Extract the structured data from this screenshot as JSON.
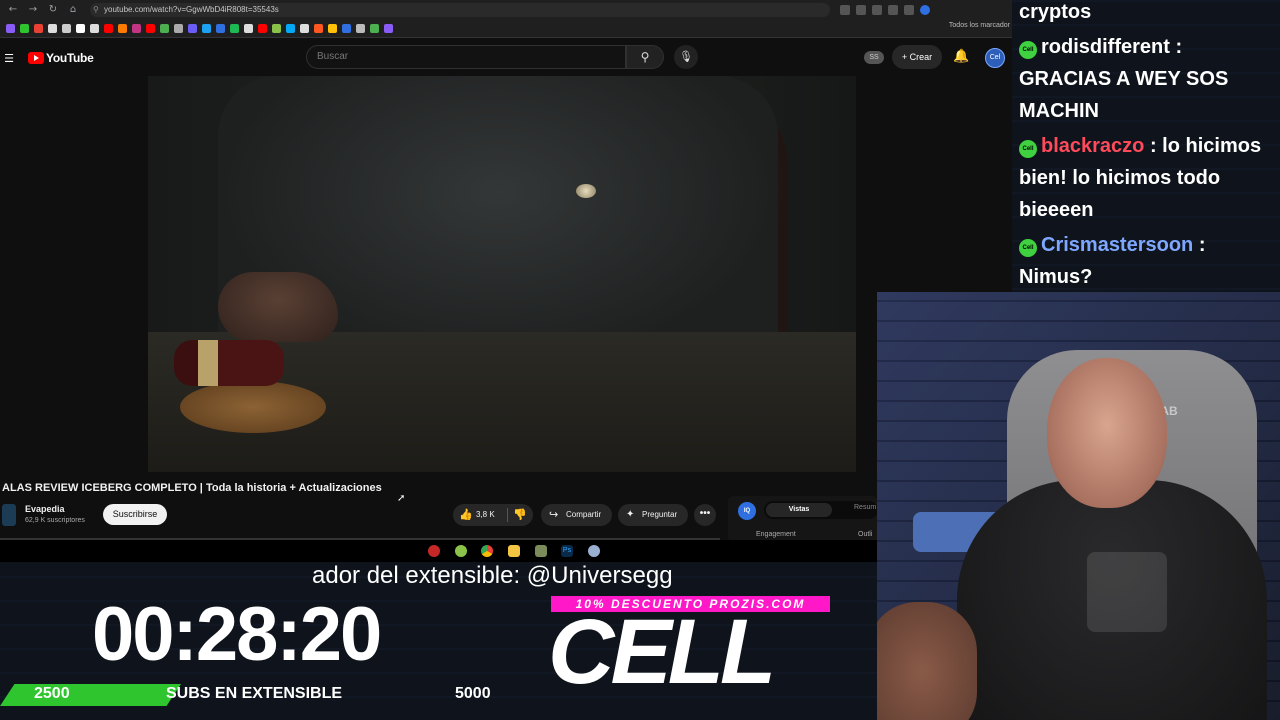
{
  "browser": {
    "url": "youtube.com/watch?v=GgwWbD4iR808t=35543s",
    "bookmarks_all": "Todos los marcador"
  },
  "youtube": {
    "logo_text": "YouTube",
    "search_placeholder": "Buscar",
    "header_badge": "SS",
    "create_label": "Crear",
    "avatar_label": "Cel"
  },
  "video": {
    "title": "ALAS REVIEW ICEBERG COMPLETO | Toda la historia + Actualizaciones",
    "channel_name": "Evapedia",
    "channel_subs": "62,9 K suscriptores",
    "subscribe_label": "Suscribirse",
    "likes": "3,8 K",
    "share_label": "Compartir",
    "ask_label": "Preguntar",
    "more_label": "•••"
  },
  "analytics_panel": {
    "logo": "IQ",
    "tab_active": "Vistas",
    "tab_other": "Resum",
    "label_engagement": "Engagement",
    "label_outlier": "Outli"
  },
  "overlay": {
    "marquee": "ador del extensible: @Universegg",
    "timer": "00:28:20",
    "promo": "10% DESCUENTO PROZIS.COM",
    "brand": "CELL",
    "subs_start": "2500",
    "subs_label": "SUBS EN EXTENSIBLE",
    "subs_goal": "5000",
    "subs_progress_fraction": 0.36
  },
  "chat": {
    "badge_text": "Cell",
    "messages": [
      {
        "user": "",
        "text": "cryptos"
      },
      {
        "user": "rodisdifferent",
        "text": ": GRACIAS A WEY SOS MACHIN",
        "color": "green"
      },
      {
        "user": "blackraczo",
        "text": ": lo hicimos bien! lo hicimos todo bieeeen",
        "color": "red"
      },
      {
        "user": "Crismastersoon",
        "text": ": Nimus?",
        "color": "blue"
      }
    ]
  },
  "webcam": {
    "chair_text": "ECRET LAB"
  },
  "colors": {
    "youtube_red": "#ff0000",
    "subs_green": "#2fc52f",
    "promo_pink": "#ff18c8",
    "chat_red_user": "#ff4a5a",
    "chat_blue_user": "#7ea7ff"
  }
}
